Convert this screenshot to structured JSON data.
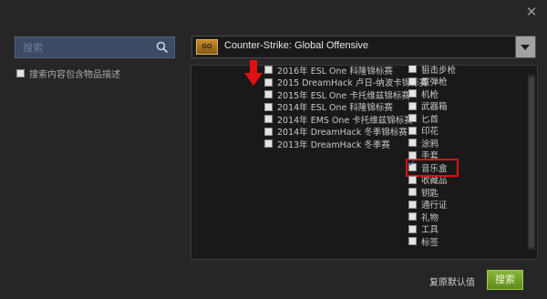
{
  "search": {
    "placeholder": "搜索",
    "value": ""
  },
  "desc_checkbox": {
    "label": "搜索内容包含物品描述",
    "checked": false
  },
  "game": {
    "name": "Counter-Strike: Global Offensive",
    "logo_text": "GO"
  },
  "events": [
    {
      "label": "2016年 ESL One 科隆锦标赛",
      "checked": false
    },
    {
      "label": "2015 DreamHack 卢日-纳波卡锦标赛",
      "checked": false
    },
    {
      "label": "2015年 ESL One 卡托维兹锦标赛",
      "checked": false
    },
    {
      "label": "2014年 ESL One 科隆锦标赛",
      "checked": false
    },
    {
      "label": "2014年 EMS One 卡托维兹锦标赛",
      "checked": false
    },
    {
      "label": "2014年 DreamHack 冬季锦标赛",
      "checked": false
    },
    {
      "label": "2013年 DreamHack 冬季赛",
      "checked": false
    }
  ],
  "types": [
    {
      "label": "狙击步枪",
      "checked": false
    },
    {
      "label": "霰弹枪",
      "checked": false
    },
    {
      "label": "机枪",
      "checked": false
    },
    {
      "label": "武器箱",
      "checked": false
    },
    {
      "label": "匕首",
      "checked": false
    },
    {
      "label": "印花",
      "checked": false
    },
    {
      "label": "涂鸦",
      "checked": false
    },
    {
      "label": "手套",
      "checked": false
    },
    {
      "label": "音乐盒",
      "checked": true,
      "highlighted": true
    },
    {
      "label": "收藏品",
      "checked": false
    },
    {
      "label": "钥匙",
      "checked": false
    },
    {
      "label": "通行证",
      "checked": false
    },
    {
      "label": "礼物",
      "checked": false
    },
    {
      "label": "工具",
      "checked": false
    },
    {
      "label": "标签",
      "checked": false
    }
  ],
  "buttons": {
    "reset": "复原默认值",
    "search": "搜索"
  },
  "colors": {
    "highlight": "#e01010",
    "search_button": "#6f9a25",
    "search_field": "#3a4b63"
  },
  "icons": {
    "close": "close-icon",
    "search": "search-icon",
    "dropdown": "chevron-down-icon",
    "arrow": "arrow-down-icon"
  }
}
